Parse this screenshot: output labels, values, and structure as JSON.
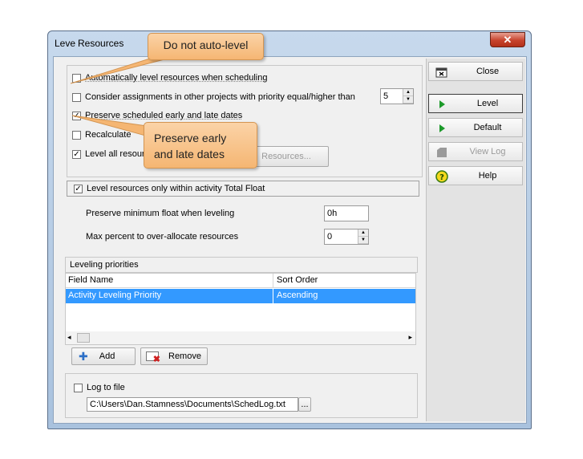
{
  "window": {
    "title_prefix": "Leve",
    "title": "Resources",
    "close_glyph": "✕"
  },
  "options": [
    {
      "label": "Automatically level resources when scheduling",
      "checked": false
    },
    {
      "label": "Consider assignments in other projects with priority equal/higher than",
      "checked": false,
      "priority_value": "5"
    },
    {
      "label": "Preserve scheduled early and late dates",
      "checked": true
    },
    {
      "label": "Recalculate",
      "checked": false
    },
    {
      "label": "Level all resour",
      "checked": true,
      "button": "Resources..."
    }
  ],
  "float_section": {
    "label": "Level resources only within activity Total Float",
    "checked": true,
    "preserve_min_float_label": "Preserve minimum float when leveling",
    "preserve_min_float_value": "0h",
    "max_percent_label": "Max percent to over-allocate resources",
    "max_percent_value": "0"
  },
  "leveling_priorities": {
    "title": "Leveling priorities",
    "columns": [
      "Field Name",
      "Sort Order"
    ],
    "rows": [
      {
        "field": "Activity Leveling Priority",
        "order": "Ascending",
        "selected": true
      }
    ],
    "add_label": "Add",
    "remove_label": "Remove"
  },
  "log": {
    "label": "Log to file",
    "checked": false,
    "path": "C:\\Users\\Dan.Stamness\\Documents\\SchedLog.txt",
    "browse_label": "..."
  },
  "side_buttons": [
    {
      "label": "Close",
      "icon": "close-window-icon",
      "enabled": true
    },
    {
      "label": "Level",
      "icon": "play-icon",
      "enabled": true
    },
    {
      "label": "Default",
      "icon": "play-icon",
      "enabled": true
    },
    {
      "label": "View Log",
      "icon": "log-icon",
      "enabled": false
    },
    {
      "label": "Help",
      "icon": "help-icon",
      "enabled": true
    }
  ],
  "callouts": {
    "top": "Do not auto-level",
    "middle_line1": "Preserve early",
    "middle_line2": "and late dates"
  },
  "colors": {
    "selection": "#3399ff",
    "callout": "#f5b673",
    "title_close": "#c7432d"
  }
}
